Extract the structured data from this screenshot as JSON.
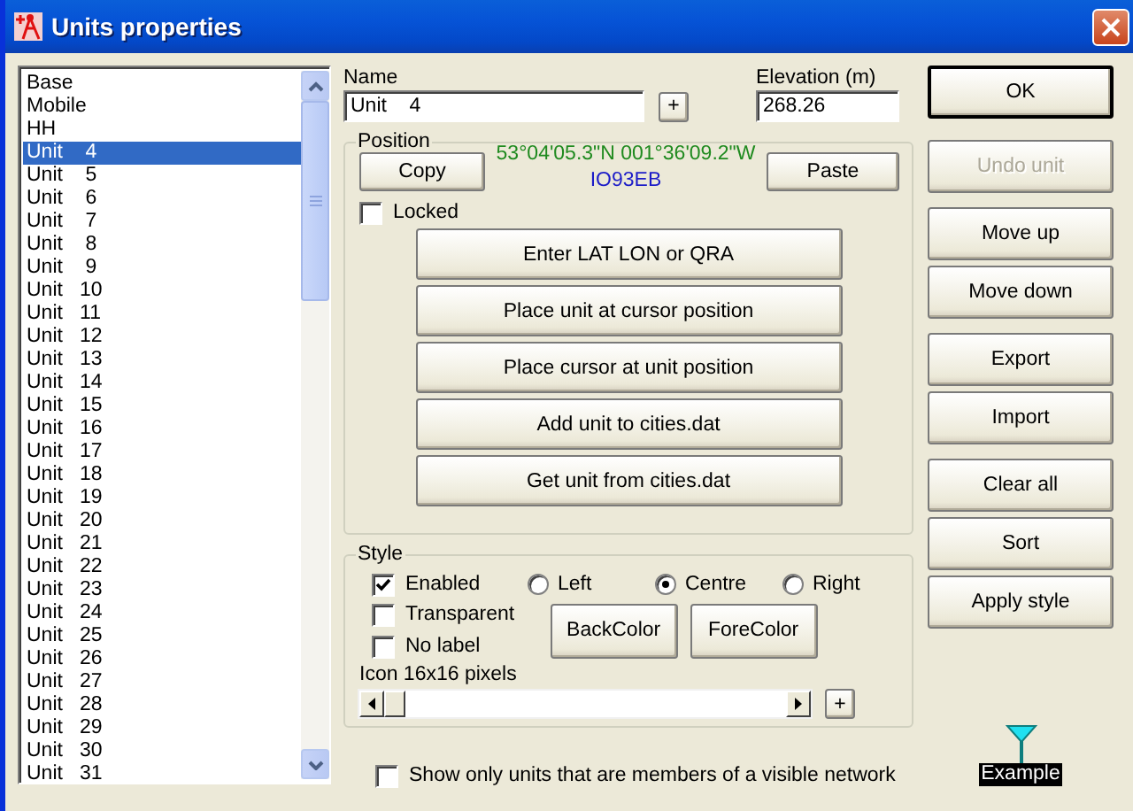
{
  "window": {
    "title": "Units properties"
  },
  "units": [
    {
      "label": "Base",
      "selected": false
    },
    {
      "label": "Mobile",
      "selected": false
    },
    {
      "label": "HH",
      "selected": false
    },
    {
      "label": "Unit    4",
      "selected": true
    },
    {
      "label": "Unit    5",
      "selected": false
    },
    {
      "label": "Unit    6",
      "selected": false
    },
    {
      "label": "Unit    7",
      "selected": false
    },
    {
      "label": "Unit    8",
      "selected": false
    },
    {
      "label": "Unit    9",
      "selected": false
    },
    {
      "label": "Unit   10",
      "selected": false
    },
    {
      "label": "Unit   11",
      "selected": false
    },
    {
      "label": "Unit   12",
      "selected": false
    },
    {
      "label": "Unit   13",
      "selected": false
    },
    {
      "label": "Unit   14",
      "selected": false
    },
    {
      "label": "Unit   15",
      "selected": false
    },
    {
      "label": "Unit   16",
      "selected": false
    },
    {
      "label": "Unit   17",
      "selected": false
    },
    {
      "label": "Unit   18",
      "selected": false
    },
    {
      "label": "Unit   19",
      "selected": false
    },
    {
      "label": "Unit   20",
      "selected": false
    },
    {
      "label": "Unit   21",
      "selected": false
    },
    {
      "label": "Unit   22",
      "selected": false
    },
    {
      "label": "Unit   23",
      "selected": false
    },
    {
      "label": "Unit   24",
      "selected": false
    },
    {
      "label": "Unit   25",
      "selected": false
    },
    {
      "label": "Unit   26",
      "selected": false
    },
    {
      "label": "Unit   27",
      "selected": false
    },
    {
      "label": "Unit   28",
      "selected": false
    },
    {
      "label": "Unit   29",
      "selected": false
    },
    {
      "label": "Unit   30",
      "selected": false
    },
    {
      "label": "Unit   31",
      "selected": false
    }
  ],
  "name": {
    "label": "Name",
    "value": "Unit    4",
    "add_button": "+"
  },
  "elevation": {
    "label": "Elevation (m)",
    "value": "268.26"
  },
  "position": {
    "title": "Position",
    "copy_button": "Copy",
    "paste_button": "Paste",
    "coordinates": "53°04'05.3\"N 001°36'09.2\"W",
    "locator": "IO93EB",
    "locked": {
      "label": "Locked",
      "checked": false
    },
    "actions": [
      "Enter LAT LON or QRA",
      "Place unit at cursor position",
      "Place cursor at unit position",
      "Add unit to cities.dat",
      "Get unit from cities.dat"
    ]
  },
  "style": {
    "title": "Style",
    "options": [
      {
        "label": "Enabled",
        "checked": true
      },
      {
        "label": "Transparent",
        "checked": false
      },
      {
        "label": "No label",
        "checked": false
      }
    ],
    "alignment": [
      {
        "label": "Left",
        "selected": false
      },
      {
        "label": "Centre",
        "selected": true
      },
      {
        "label": "Right",
        "selected": false
      }
    ],
    "back_color_button": "BackColor",
    "fore_color_button": "ForeColor",
    "icon_size_label": "Icon 16x16 pixels",
    "icon_size": {
      "level": 0
    },
    "add_button": "+"
  },
  "network_filter": {
    "label": "Show only units that are members of a visible network",
    "checked": false
  },
  "side_buttons": [
    [
      {
        "label": "OK",
        "default": true,
        "disabled": false
      }
    ],
    [
      {
        "label": "Undo unit",
        "default": false,
        "disabled": true
      }
    ],
    [
      {
        "label": "Move up",
        "default": false,
        "disabled": false
      },
      {
        "label": "Move down",
        "default": false,
        "disabled": false
      }
    ],
    [
      {
        "label": "Export",
        "default": false,
        "disabled": false
      },
      {
        "label": "Import",
        "default": false,
        "disabled": false
      }
    ],
    [
      {
        "label": "Clear all",
        "default": false,
        "disabled": false
      },
      {
        "label": "Sort",
        "default": false,
        "disabled": false
      },
      {
        "label": "Apply style",
        "default": false,
        "disabled": false
      }
    ]
  ],
  "example": {
    "label": "Example"
  }
}
